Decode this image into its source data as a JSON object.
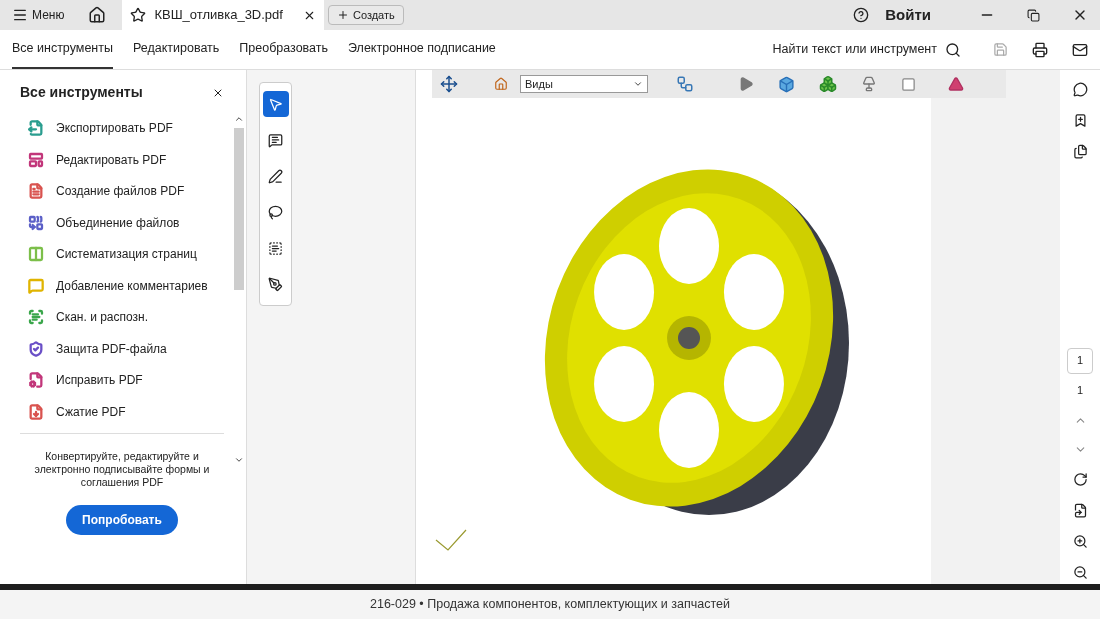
{
  "titlebar": {
    "menu": "Меню",
    "document_tab": "КВШ_отливка_3D.pdf",
    "create": "Создать",
    "sign_in": "Войти"
  },
  "tabs": [
    {
      "label": "Все инструменты",
      "selected": true
    },
    {
      "label": "Редактировать",
      "selected": false
    },
    {
      "label": "Преобразовать",
      "selected": false
    },
    {
      "label": "Электронное подписание",
      "selected": false
    }
  ],
  "search": {
    "label": "Найти текст или инструмент"
  },
  "tools_panel": {
    "title": "Все инструменты",
    "items": [
      {
        "label": "Экспортировать PDF",
        "color": "#2a9d8f"
      },
      {
        "label": "Редактировать PDF",
        "color": "#c2367a"
      },
      {
        "label": "Создание файлов PDF",
        "color": "#d9534f"
      },
      {
        "label": "Объединение файлов",
        "color": "#5b5fc7"
      },
      {
        "label": "Систематизация страниц",
        "color": "#7cbf4a"
      },
      {
        "label": "Добавление комментариев",
        "color": "#e0b400"
      },
      {
        "label": "Скан. и распозн.",
        "color": "#3aa64b"
      },
      {
        "label": "Защита PDF-файла",
        "color": "#6a4fc7"
      },
      {
        "label": "Исправить PDF",
        "color": "#c2367a"
      },
      {
        "label": "Сжатие PDF",
        "color": "#d9534f"
      }
    ],
    "promo": "Конвертируйте, редактируйте и электронно подписывайте формы и соглашения PDF",
    "try_button": "Попробовать"
  },
  "viewer_toolbar": {
    "views": "Виды"
  },
  "page_nav": {
    "current": "1",
    "total": "1"
  },
  "caption": "216-029 • Продажа компонентов, комплектующих и запчастей"
}
